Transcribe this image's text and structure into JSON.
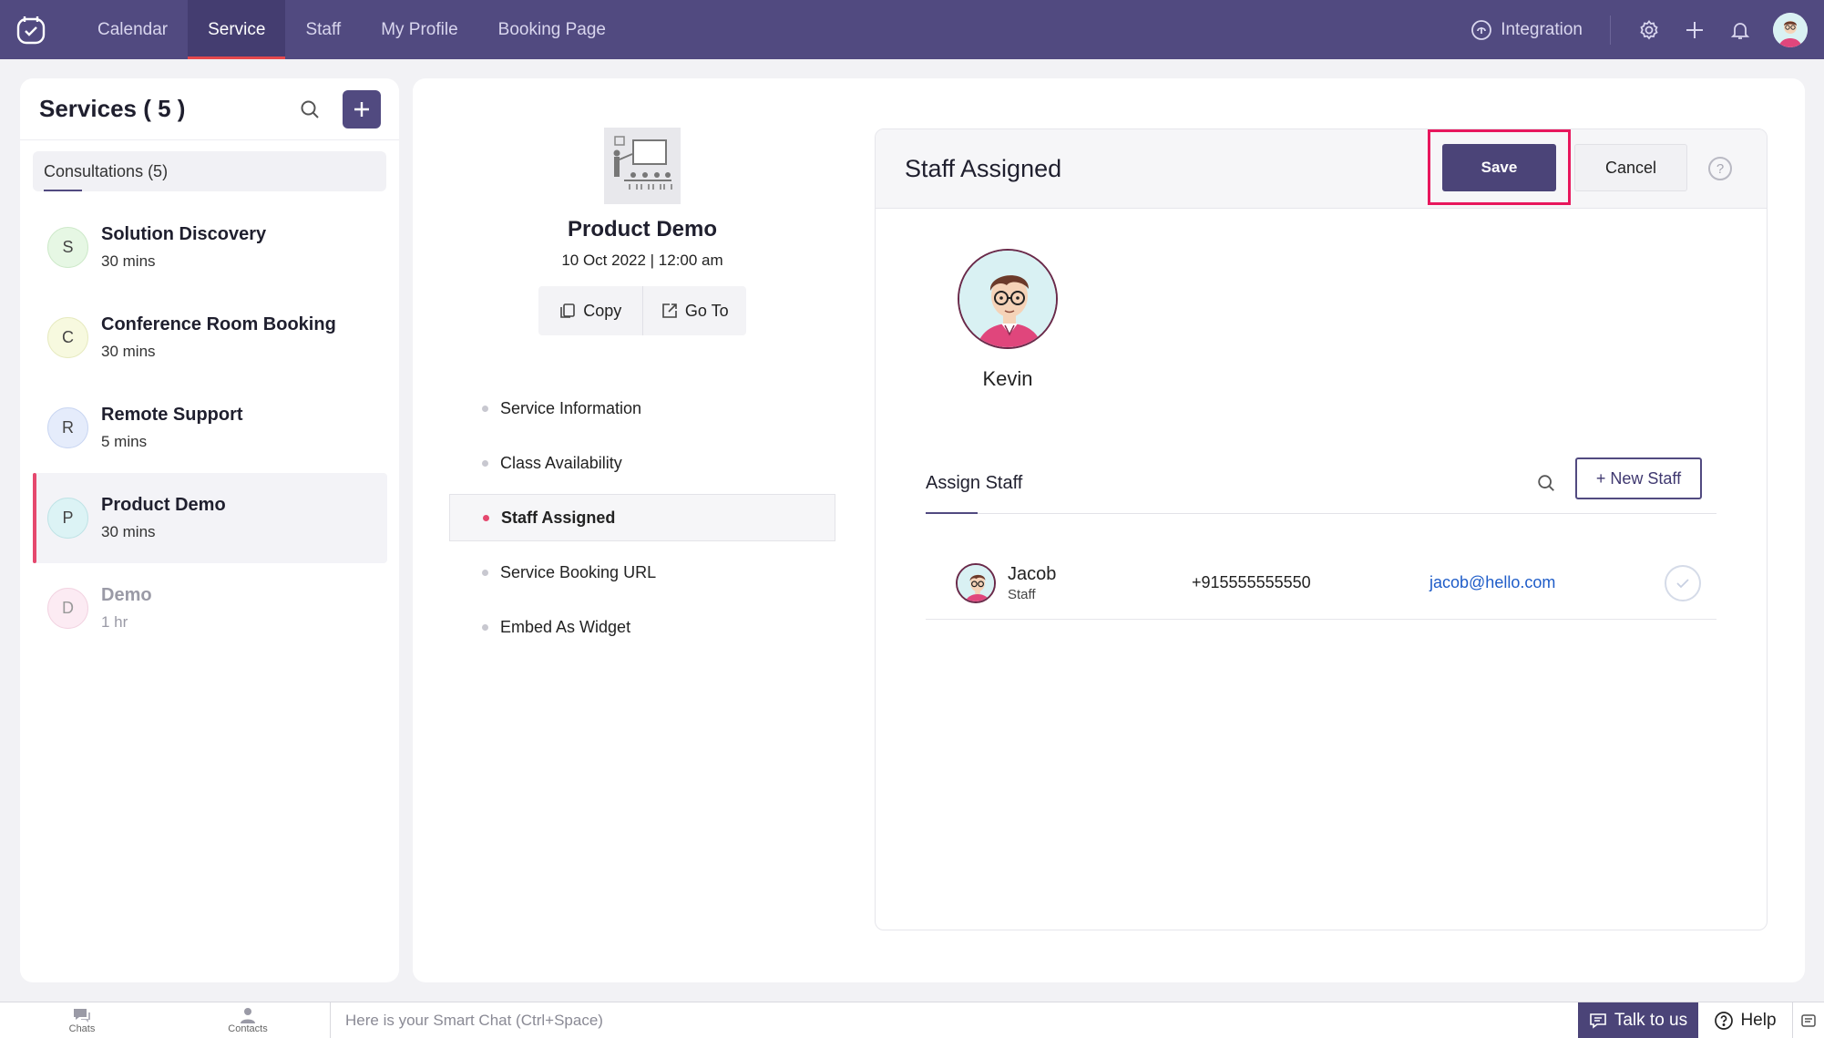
{
  "nav": {
    "tabs": [
      "Calendar",
      "Service",
      "Staff",
      "My Profile",
      "Booking Page"
    ],
    "active_tab": "Service",
    "integration_label": "Integration"
  },
  "services_panel": {
    "title": "Services ( 5 )",
    "category_tab": "Consultations (5)",
    "items": [
      {
        "initial": "S",
        "name": "Solution Discovery",
        "duration": "30 mins",
        "color": "#e6f7e4"
      },
      {
        "initial": "C",
        "name": "Conference Room Booking",
        "duration": "30 mins",
        "color": "#f7f9df"
      },
      {
        "initial": "R",
        "name": "Remote Support",
        "duration": "5 mins",
        "color": "#e5ecfb"
      },
      {
        "initial": "P",
        "name": "Product Demo",
        "duration": "30 mins",
        "color": "#dcf3f5"
      },
      {
        "initial": "D",
        "name": "Demo",
        "duration": "1 hr",
        "color": "#fcebf3"
      }
    ]
  },
  "service_summary": {
    "title": "Product Demo",
    "date": "10 Oct 2022 | 12:00 am",
    "copy_label": "Copy",
    "goto_label": "Go To"
  },
  "side_menu": {
    "items": [
      "Service Information",
      "Class Availability",
      "Staff Assigned",
      "Service Booking URL",
      "Embed As Widget"
    ],
    "active": "Staff Assigned"
  },
  "staff_card": {
    "title": "Staff Assigned",
    "save_label": "Save",
    "cancel_label": "Cancel",
    "help_label": "?",
    "assigned_name": "Kevin",
    "assign_title": "Assign Staff",
    "new_staff_label": "+ New Staff",
    "staff_rows": [
      {
        "name": "Jacob",
        "role": "Staff",
        "phone": "+915555555550",
        "email": "jacob@hello.com"
      }
    ]
  },
  "bottom_bar": {
    "chats_label": "Chats",
    "contacts_label": "Contacts",
    "chat_placeholder": "Here is your Smart Chat (Ctrl+Space)",
    "talk_label": "Talk to us",
    "help_label": "Help"
  },
  "colors": {
    "brand": "#514a80",
    "highlight": "#e8175d",
    "active_marker": "#e5486e",
    "link": "#1e5cc8"
  }
}
